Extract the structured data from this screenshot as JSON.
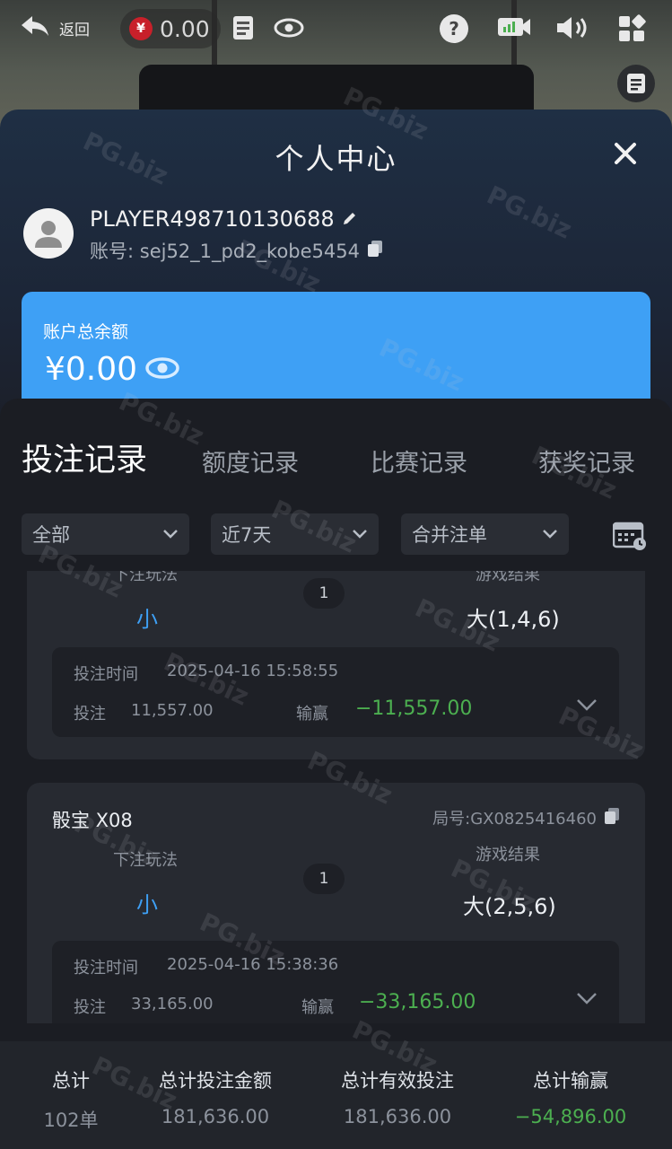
{
  "topbar": {
    "back_label": "返回",
    "currency_symbol": "¥",
    "balance": "0.00"
  },
  "sheet": {
    "title": "个人中心",
    "player_name": "PLAYER498710130688",
    "account": "账号: sej52_1_pd2_kobe5454",
    "balance_label": "账户总余额",
    "balance_value": "¥0.00"
  },
  "tabs": [
    {
      "label": "投注记录",
      "active": true
    },
    {
      "label": "额度记录",
      "active": false
    },
    {
      "label": "比赛记录",
      "active": false
    },
    {
      "label": "获奖记录",
      "active": false
    }
  ],
  "filters": {
    "type": "全部",
    "range": "近7天",
    "merge": "合并注单"
  },
  "records": [
    {
      "game": "",
      "round": "",
      "play_label": "下注玩法",
      "result_label": "游戏结果",
      "pick": "小",
      "count": "1",
      "result": "大(1,4,6)",
      "time_label": "投注时间",
      "time": "2025-04-16 15:58:55",
      "bet_label": "投注",
      "bet": "11,557.00",
      "win_label": "输赢",
      "win": "−11,557.00"
    },
    {
      "game": "骰宝 X08",
      "round": "局号:GX0825416460",
      "play_label": "下注玩法",
      "result_label": "游戏结果",
      "pick": "小",
      "count": "1",
      "result": "大(2,5,6)",
      "time_label": "投注时间",
      "time": "2025-04-16 15:38:36",
      "bet_label": "投注",
      "bet": "33,165.00",
      "win_label": "输赢",
      "win": "−33,165.00"
    }
  ],
  "totals": {
    "count_label": "总计",
    "count": "102单",
    "bet_label": "总计投注金额",
    "bet": "181,636.00",
    "valid_label": "总计有效投注",
    "valid": "181,636.00",
    "win_label": "总计输赢",
    "win": "−54,896.00"
  },
  "watermark": "PG.biz"
}
